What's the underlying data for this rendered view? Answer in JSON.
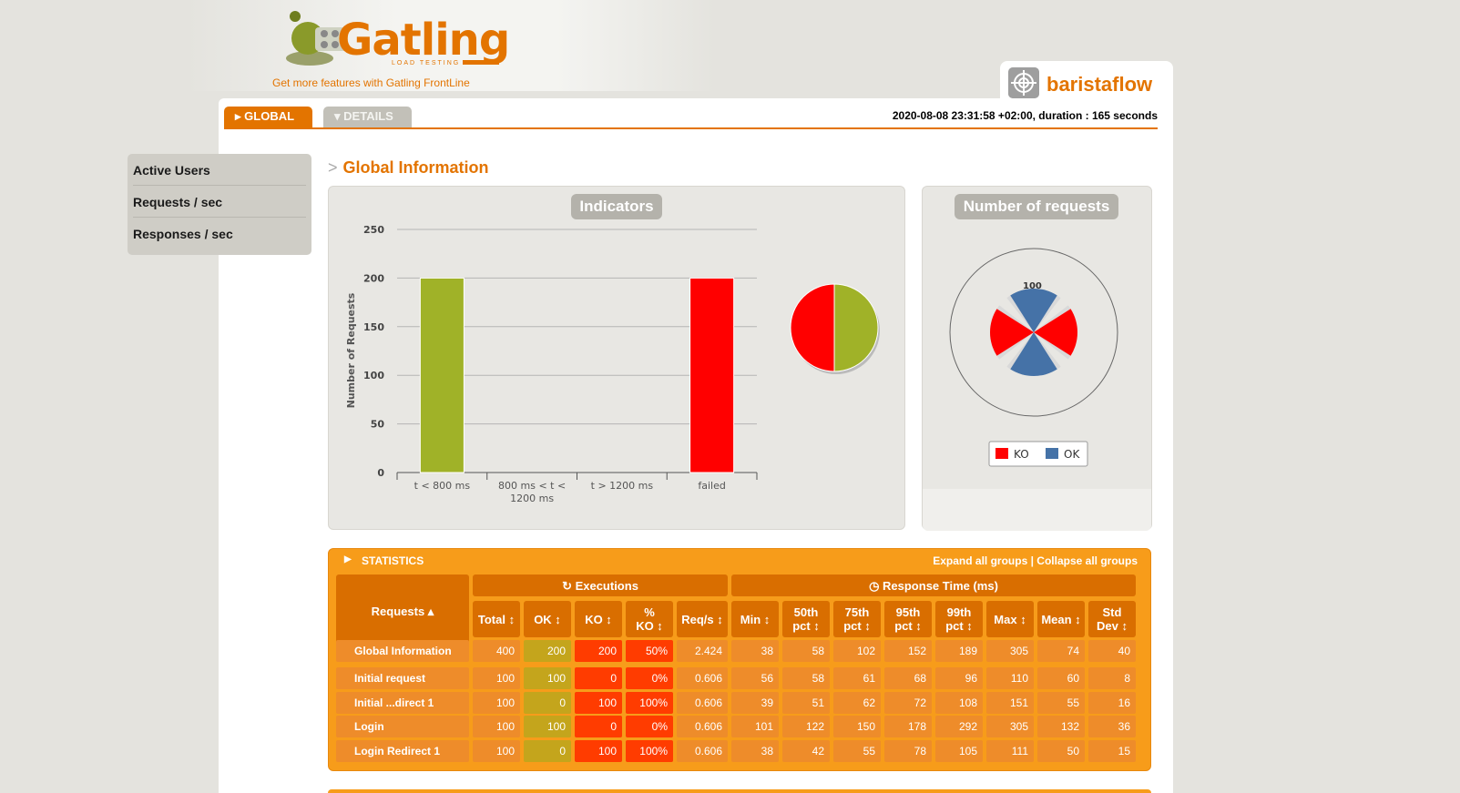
{
  "brand": {
    "logo_text": "Gatling",
    "logo_sub": "LOAD TESTING",
    "frontline_link": "Get more features with Gatling FrontLine"
  },
  "simulation": {
    "name": "baristaflow"
  },
  "tabs": {
    "global": "GLOBAL",
    "details": "DETAILS"
  },
  "run_info": "2020-08-08 23:31:58 +02:00, duration : 165 seconds",
  "sidebar": {
    "items": [
      {
        "label": "Active Users"
      },
      {
        "label": "Requests / sec"
      },
      {
        "label": "Responses / sec"
      }
    ]
  },
  "section": {
    "title": "Global Information"
  },
  "indicators": {
    "heading": "Indicators"
  },
  "requests_panel": {
    "heading": "Number of requests"
  },
  "colors": {
    "accent": "#e37400",
    "ok_green": "#a0b228",
    "ko_red": "#ff0000",
    "ok_blue": "#4572a7",
    "stats_bg": "#f79c1a"
  },
  "chart_data": [
    {
      "type": "bar",
      "title": "Indicators",
      "ylabel": "Number of Requests",
      "xlabel": "",
      "categories": [
        "t < 800 ms",
        "800 ms < t < 1200 ms",
        "t > 1200 ms",
        "failed"
      ],
      "values": [
        200,
        0,
        0,
        200
      ],
      "bar_colors": [
        "#a0b228",
        "#a0b228",
        "#a0b228",
        "#ff0000"
      ],
      "yticks": [
        0,
        50,
        100,
        150,
        200,
        250
      ],
      "ylim": [
        0,
        250
      ],
      "grid": true
    },
    {
      "type": "pie",
      "labels": [
        "t < 800 ms",
        "failed"
      ],
      "values": [
        200,
        200
      ],
      "colors": [
        "#a0b228",
        "#ff0000"
      ]
    },
    {
      "type": "pie",
      "title": "Number of requests",
      "radial_label": "100",
      "slices": [
        {
          "name": "OK",
          "value": 100
        },
        {
          "name": "KO",
          "value": 100
        },
        {
          "name": "OK",
          "value": 100
        },
        {
          "name": "KO",
          "value": 100
        }
      ],
      "legend": [
        {
          "name": "KO",
          "color": "#ff0000"
        },
        {
          "name": "OK",
          "color": "#4572a7"
        }
      ],
      "legend_position": "bottom"
    }
  ],
  "statistics": {
    "title": "STATISTICS",
    "expand_all": "Expand all groups",
    "separator": "|",
    "collapse_all": "Collapse all groups",
    "group_headers": {
      "requests": "Requests",
      "executions": "Executions",
      "response_time": "Response Time (ms)"
    },
    "columns": [
      "Total",
      "OK",
      "KO",
      "% KO",
      "Req/s",
      "Min",
      "50th pct",
      "75th pct",
      "95th pct",
      "99th pct",
      "Max",
      "Mean",
      "Std Dev"
    ],
    "global_row": {
      "name": "Global Information",
      "values": [
        "400",
        "200",
        "200",
        "50%",
        "2.424",
        "38",
        "58",
        "102",
        "152",
        "189",
        "305",
        "74",
        "40"
      ]
    },
    "rows": [
      {
        "name": "Initial request",
        "values": [
          "100",
          "100",
          "0",
          "0%",
          "0.606",
          "56",
          "58",
          "61",
          "68",
          "96",
          "110",
          "60",
          "8"
        ]
      },
      {
        "name": "Initial ...direct 1",
        "values": [
          "100",
          "0",
          "100",
          "100%",
          "0.606",
          "39",
          "51",
          "62",
          "72",
          "108",
          "151",
          "55",
          "16"
        ]
      },
      {
        "name": "Login",
        "values": [
          "100",
          "100",
          "0",
          "0%",
          "0.606",
          "101",
          "122",
          "150",
          "178",
          "292",
          "305",
          "132",
          "36"
        ]
      },
      {
        "name": "Login Redirect 1",
        "values": [
          "100",
          "0",
          "100",
          "100%",
          "0.606",
          "38",
          "42",
          "55",
          "78",
          "105",
          "111",
          "50",
          "15"
        ]
      }
    ]
  }
}
